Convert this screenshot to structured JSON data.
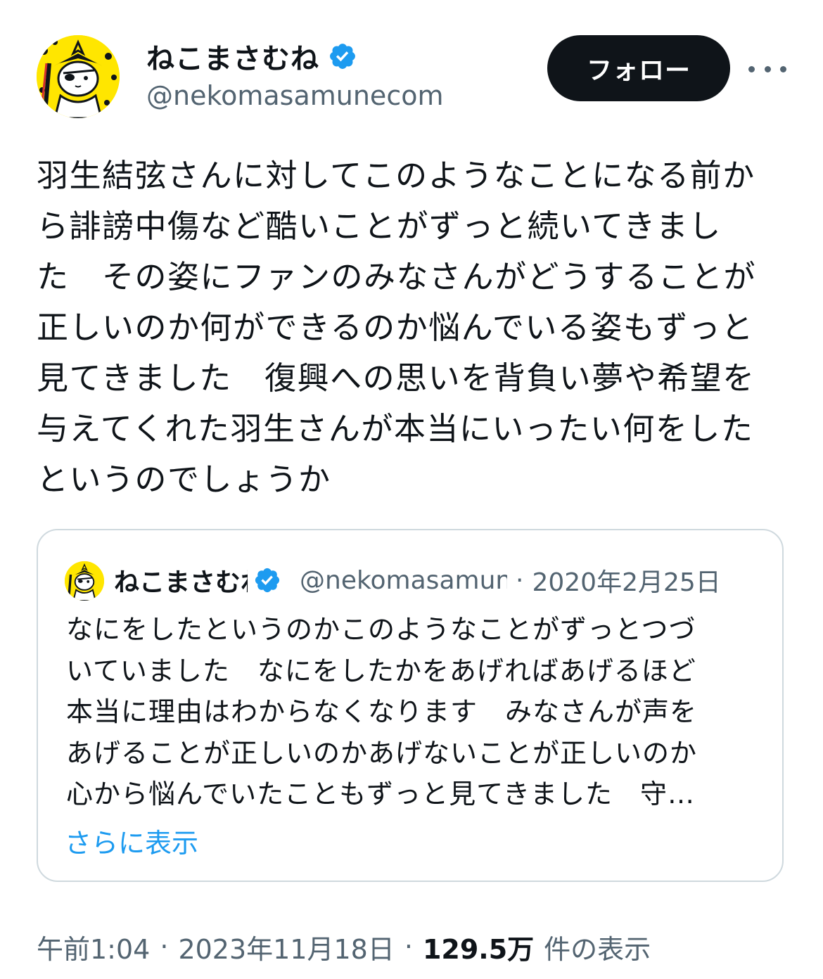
{
  "author": {
    "display_name": "ねこまさむね",
    "handle": "@nekomasamunecom",
    "verified_icon": "verified-badge-icon",
    "avatar_icon": "cat-samurai-avatar"
  },
  "actions": {
    "follow_label": "フォロー",
    "more_icon": "more-options-icon"
  },
  "tweet": {
    "lines": [
      "羽生結弦さんに対してこのようなことになる前か",
      "ら誹謗中傷など酷いことがずっと続いてきまし",
      "た　その姿にファンのみなさんがどうすることが",
      "正しいのか何ができるのか悩んでいる姿もずっと",
      "見てきました　復興への思いを背負い夢や希望を",
      "与えてくれた羽生さんが本当にいったい何をした",
      "というのでしょうか"
    ]
  },
  "quote": {
    "display_name": "ねこまさむね",
    "handle": "@nekomasamunecom",
    "separator": "·",
    "date": "2020年2月25日",
    "lines": [
      "なにをしたというのかこのようなことがずっとつづ",
      "いていました　なにをしたかをあげればあげるほど",
      "本当に理由はわからなくなります　みなさんが声を",
      "あげることが正しいのかあげないことが正しいのか",
      "心から悩んでいたこともずっと見てきました　守…"
    ],
    "show_more_label": "さらに表示"
  },
  "meta": {
    "time": "午前1:04",
    "separator": "·",
    "date": "2023年11月18日",
    "views_count": "129.5万",
    "views_label": "件の表示"
  },
  "colors": {
    "text": "#0f1419",
    "secondary": "#536471",
    "accent": "#1d9bf0",
    "button_bg": "#0f1419",
    "border": "#cfd9de",
    "avatar_bg": "#ffe600"
  }
}
